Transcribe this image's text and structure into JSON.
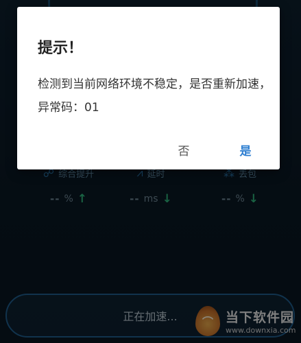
{
  "stats": [
    {
      "label": "综合提升",
      "value": "--",
      "unit": "%",
      "arrow": "up",
      "icon": "chart-icon"
    },
    {
      "label": "延时",
      "value": "--",
      "unit": "ms",
      "arrow": "down",
      "icon": "wave-icon"
    },
    {
      "label": "丢包",
      "value": "--",
      "unit": "%",
      "arrow": "down",
      "icon": "packet-icon"
    }
  ],
  "accelerate_button": {
    "label": "正在加速..."
  },
  "watermark": {
    "cn": "当下软件园",
    "en": "www.downxia.com"
  },
  "dialog": {
    "title": "提示！",
    "message": "检测到当前网络环境不稳定，是否重新加速，异常码：01",
    "no_label": "否",
    "yes_label": "是"
  },
  "colors": {
    "background": "#0b1a26",
    "accent": "#2f7fd1",
    "arrow": "#2fb37a"
  }
}
